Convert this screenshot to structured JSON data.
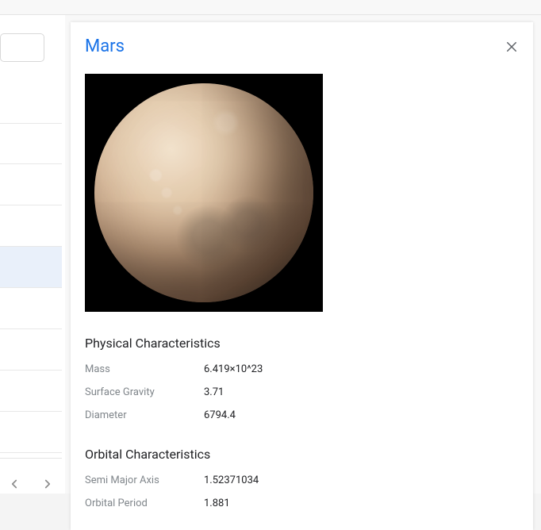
{
  "title": "Mars",
  "sections": {
    "physical": {
      "heading": "Physical Characteristics",
      "rows": {
        "mass": {
          "label": "Mass",
          "value": "6.419×10^23"
        },
        "surfaceGravity": {
          "label": "Surface Gravity",
          "value": "3.71"
        },
        "diameter": {
          "label": "Diameter",
          "value": "6794.4"
        }
      }
    },
    "orbital": {
      "heading": "Orbital Characteristics",
      "rows": {
        "semiMajorAxis": {
          "label": "Semi Major Axis",
          "value": "1.52371034"
        },
        "orbitalPeriod": {
          "label": "Orbital Period",
          "value": "1.881"
        }
      }
    }
  }
}
